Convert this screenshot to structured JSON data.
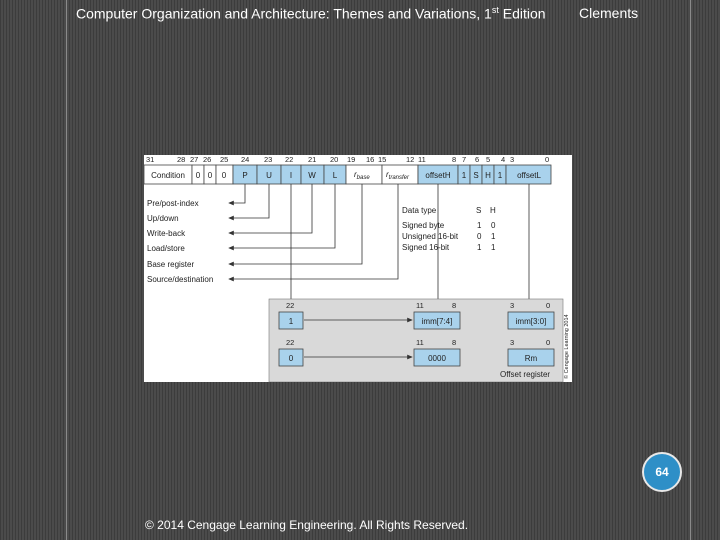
{
  "header": {
    "title_main": "Computer Organization and Architecture: Themes and Variations, 1",
    "title_sup": "st",
    "title_tail": " Edition",
    "author": "Clements"
  },
  "page_number": "64",
  "footer": "© 2014 Cengage Learning Engineering. All Rights Reserved.",
  "figure": {
    "bit_positions": [
      "31",
      "28",
      "27",
      "26",
      "25",
      "24",
      "23",
      "22",
      "21",
      "20",
      "19",
      "16",
      "15",
      "12",
      "11",
      "8",
      "7",
      "6",
      "5",
      "4",
      "3",
      "0"
    ],
    "fields": {
      "condition": "Condition",
      "z0": "0",
      "z1": "0",
      "z2": "0",
      "p": "P",
      "u": "U",
      "i": "I",
      "w": "W",
      "l": "L",
      "rbase": "r",
      "rbase_sub": "base",
      "rtransfer": "r",
      "rtransfer_sub": "transfer",
      "offsetH": "offsetH",
      "one_a": "1",
      "s": "S",
      "h": "H",
      "one_b": "1",
      "offsetL": "offsetL"
    },
    "labels": [
      "Pre/post-index",
      "Up/down",
      "Write-back",
      "Load/store",
      "Base register",
      "Source/destination"
    ],
    "data_type_table": {
      "headers": [
        "Data type",
        "S",
        "H"
      ],
      "rows": [
        [
          "Signed byte",
          "1",
          "0"
        ],
        [
          "Unsigned 16-bit",
          "0",
          "1"
        ],
        [
          "Signed 16-bit",
          "1",
          "1"
        ]
      ]
    },
    "offset_box": {
      "row1": {
        "bit22": "22",
        "bit11": "11",
        "bit8": "8",
        "bit3": "3",
        "bit0": "0",
        "i_value": "1",
        "field_mid": "imm[7:4]",
        "field_right": "imm[3:0]"
      },
      "row2": {
        "bit22": "22",
        "bit11": "11",
        "bit8": "8",
        "bit3": "3",
        "bit0": "0",
        "i_value": "0",
        "field_mid": "0000",
        "field_right": "Rm"
      },
      "caption": "Offset register"
    },
    "copyright_vertical": "© Cengage Learning 2014"
  }
}
